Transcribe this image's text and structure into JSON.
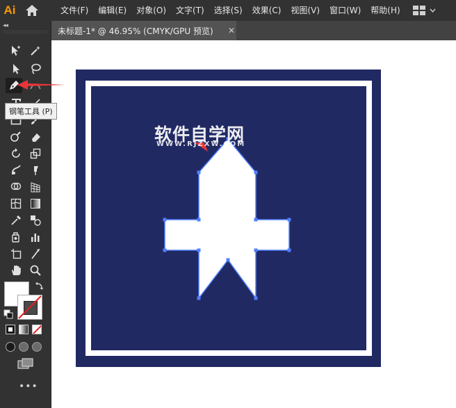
{
  "app": {
    "logo": "Ai"
  },
  "menu": [
    "文件(F)",
    "编辑(E)",
    "对象(O)",
    "文字(T)",
    "选择(S)",
    "效果(C)",
    "视图(V)",
    "窗口(W)",
    "帮助(H)"
  ],
  "toolbar": {
    "collapse_glyph": "◂◂",
    "tooltip": "钢笔工具 (P)",
    "more": "•••",
    "tools": [
      "selection-icon",
      "magic-wand-icon",
      "direct-selection-icon",
      "lasso-icon",
      "pen-icon",
      "curvature-icon",
      "type-icon",
      "line-icon",
      "rectangle-icon",
      "paintbrush-icon",
      "shaper-icon",
      "eraser-icon",
      "rotate-icon",
      "scale-icon",
      "warp-icon",
      "puppet-warp-icon",
      "shape-builder-icon",
      "perspective-grid-icon",
      "mesh-icon",
      "gradient-icon",
      "eyedropper-icon",
      "blend-icon",
      "symbol-sprayer-icon",
      "column-graph-icon",
      "artboard-icon",
      "slice-icon",
      "hand-icon",
      "zoom-icon"
    ]
  },
  "document": {
    "tab_title": "未标题-1* @ 46.95% (CMYK/GPU 预览)",
    "close": "✕"
  },
  "watermark": {
    "name": "软件自学网",
    "url": "WWW.RJZXW.COM"
  },
  "colors": {
    "artboard_fill": "#212963",
    "border": "#ffffff",
    "path_stroke": "#4f7fff",
    "accent": "#ff9a00",
    "arrow": "#e8343a"
  }
}
